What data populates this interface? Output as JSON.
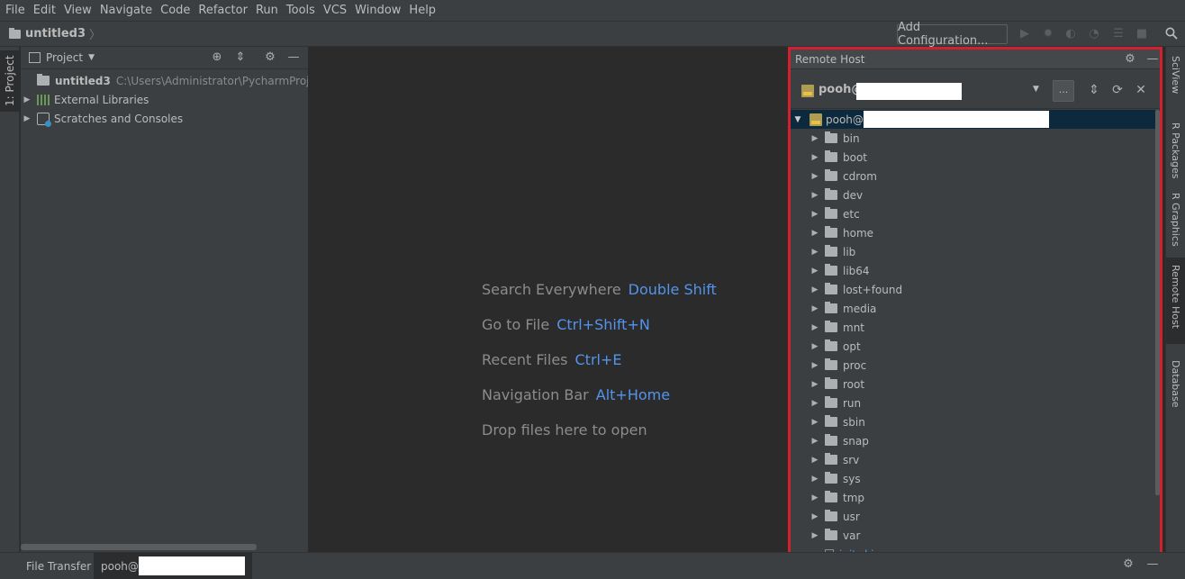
{
  "menu": [
    "File",
    "Edit",
    "View",
    "Navigate",
    "Code",
    "Refactor",
    "Run",
    "Tools",
    "VCS",
    "Window",
    "Help"
  ],
  "breadcrumb": {
    "project": "untitled3",
    "separator": "〉"
  },
  "toolbar": {
    "add_configuration": "Add Configuration..."
  },
  "left_strip": {
    "project_tab": "1: Project"
  },
  "project_panel": {
    "title": "Project",
    "items": [
      {
        "label": "untitled3",
        "path": "C:\\Users\\Administrator\\PycharmProjects"
      },
      {
        "label": "External Libraries"
      },
      {
        "label": "Scratches and Consoles"
      }
    ]
  },
  "editor": {
    "hints": [
      {
        "label": "Search Everywhere",
        "key": "Double Shift"
      },
      {
        "label": "Go to File",
        "key": "Ctrl+Shift+N"
      },
      {
        "label": "Recent Files",
        "key": "Ctrl+E"
      },
      {
        "label": "Navigation Bar",
        "key": "Alt+Home"
      },
      {
        "label": "Drop files here to open",
        "key": ""
      }
    ]
  },
  "remote_host": {
    "title": "Remote Host",
    "host_label": "pooh@",
    "browse_label": "...",
    "root_label": "pooh@",
    "folders": [
      "bin",
      "boot",
      "cdrom",
      "dev",
      "etc",
      "home",
      "lib",
      "lib64",
      "lost+found",
      "media",
      "mnt",
      "opt",
      "proc",
      "root",
      "run",
      "sbin",
      "snap",
      "srv",
      "sys",
      "tmp",
      "usr",
      "var"
    ],
    "partial_file": "initrd.img"
  },
  "right_strip": [
    "SciView",
    "R Packages",
    "R Graphics",
    "Remote Host",
    "Database"
  ],
  "bottom_bar": {
    "file_transfer": "File Transfer",
    "host_tab": "pooh@"
  }
}
